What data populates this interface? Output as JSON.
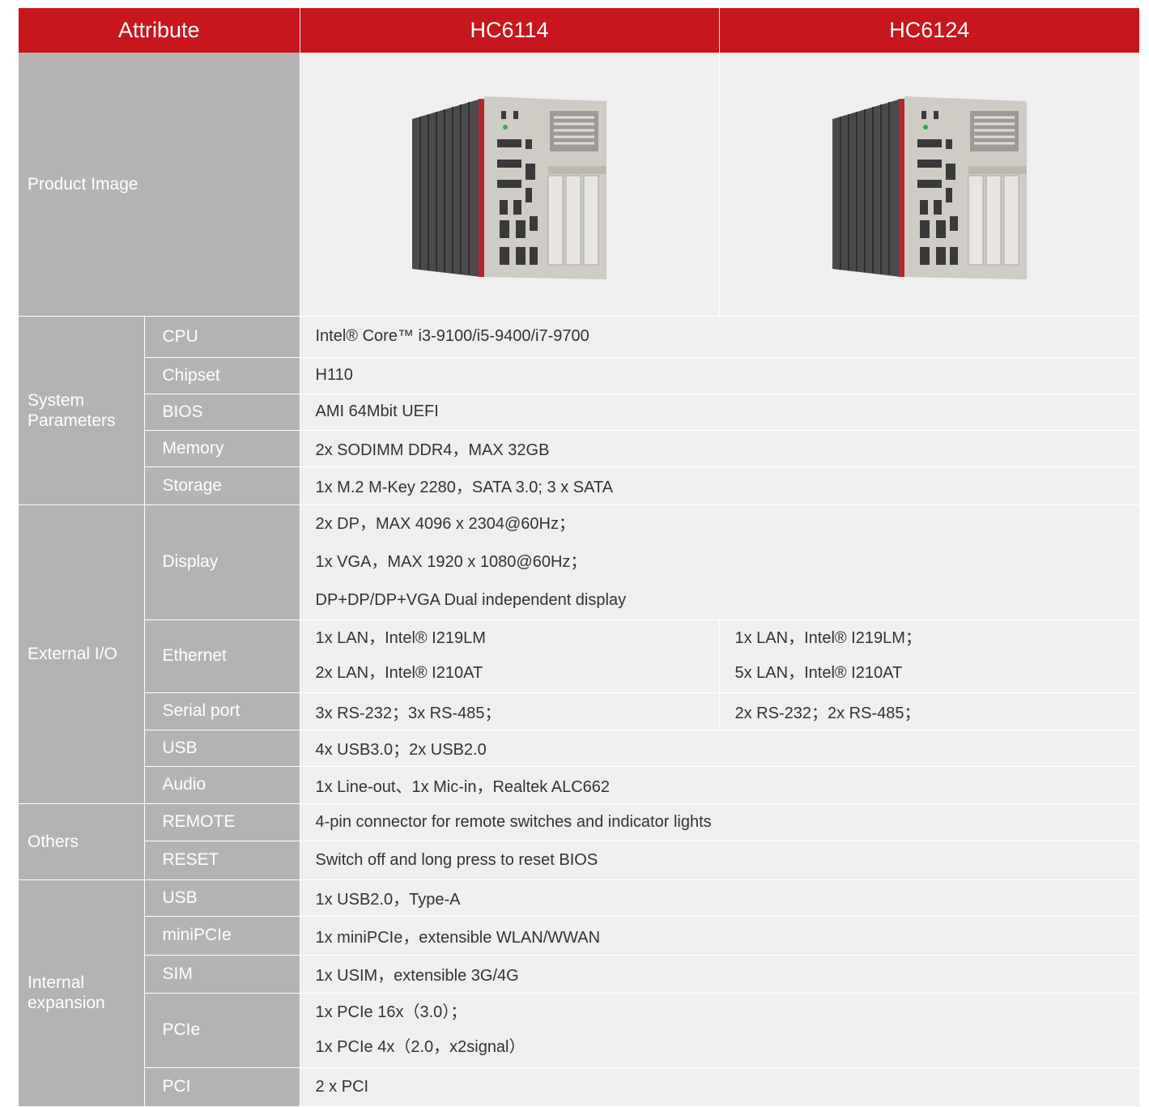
{
  "header": {
    "attribute": "Attribute",
    "model_a": "HC6114",
    "model_b": "HC6124"
  },
  "product_image_label": "Product Image",
  "system": {
    "group": "System Parameters",
    "cpu_label": "CPU",
    "cpu_value": "Intel® Core™ i3-9100/i5-9400/i7-9700",
    "chipset_label": "Chipset",
    "chipset_value": "H110",
    "bios_label": "BIOS",
    "bios_value": "AMI 64Mbit UEFI",
    "memory_label": "Memory",
    "memory_value": "2x SODIMM DDR4，MAX 32GB",
    "storage_label": "Storage",
    "storage_value": "1x M.2 M-Key 2280，SATA 3.0; 3 x SATA"
  },
  "external_io": {
    "group": "External I/O",
    "display_label": "Display",
    "display_lines": [
      "2x DP，MAX 4096 x 2304@60Hz；",
      "1x VGA，MAX 1920 x 1080@60Hz；",
      "DP+DP/DP+VGA Dual independent display"
    ],
    "ethernet_label": "Ethernet",
    "ethernet_a": [
      "1x LAN，Intel® I219LM",
      "2x LAN，Intel® I210AT"
    ],
    "ethernet_b": [
      "1x LAN，Intel® I219LM；",
      "5x LAN，Intel® I210AT"
    ],
    "serial_label": "Serial port",
    "serial_a": "3x RS-232；3x RS-485；",
    "serial_b": "2x RS-232；2x RS-485；",
    "usb_label": "USB",
    "usb_value": "4x USB3.0；2x USB2.0",
    "audio_label": "Audio",
    "audio_value": "1x Line-out、1x Mic-in，Realtek ALC662"
  },
  "others": {
    "group": "Others",
    "remote_label": "REMOTE",
    "remote_value": "4-pin connector for remote switches and indicator lights",
    "reset_label": "RESET",
    "reset_value": "Switch off and long press to reset BIOS"
  },
  "internal": {
    "group": "Internal expansion",
    "usb_label": "USB",
    "usb_value": "1x USB2.0，Type-A",
    "minipcie_label": "miniPCIe",
    "minipcie_value": "1x miniPCIe，extensible WLAN/WWAN",
    "sim_label": "SIM",
    "sim_value": "1x USIM，extensible 3G/4G",
    "pcie_label": "PCIe",
    "pcie_lines": [
      "1x PCIe 16x（3.0）；",
      "1x PCIe 4x（2.0，x2signal）"
    ],
    "pci_label": "PCI",
    "pci_value": "2 x PCI"
  },
  "colors": {
    "header_red": "#c8161d",
    "label_gray": "#b3b3b3",
    "value_bg": "#efefef"
  }
}
